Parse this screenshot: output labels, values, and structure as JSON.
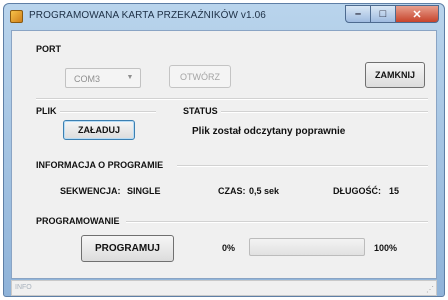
{
  "window": {
    "title": "PROGRAMOWANA KARTA PRZEKAŹNIKÓW v1.06",
    "minimize_glyph": "–",
    "maximize_glyph": "□",
    "close_glyph": "✕"
  },
  "port": {
    "label": "PORT",
    "selected": "COM3",
    "open_button": "OTWÓRZ",
    "close_button": "ZAMKNIJ"
  },
  "file": {
    "label": "PLIK",
    "load_button": "ZAŁADUJ"
  },
  "status": {
    "label": "STATUS",
    "message": "Plik został odczytany poprawnie"
  },
  "program_info": {
    "label": "INFORMACJA O PROGRAMIE",
    "sequence_label": "SEKWENCJA:",
    "sequence_value": "SINGLE",
    "time_label": "CZAS:",
    "time_value": "0,5 sek",
    "length_label": "DŁUGOŚĆ:",
    "length_value": "15"
  },
  "programming": {
    "label": "PROGRAMOWANIE",
    "program_button": "PROGRAMUJ",
    "progress_min": "0%",
    "progress_max": "100%",
    "progress_value": 0
  },
  "statusbar": {
    "text": "INFO"
  },
  "icons": {
    "combo_arrow": "chevron-down-icon",
    "app": "app-icon",
    "resize": "resize-grip-icon"
  },
  "colors": {
    "title_gradient_top": "#b9d4ec",
    "close_button": "#c7432b",
    "progress_fill": "#3bb54a"
  }
}
